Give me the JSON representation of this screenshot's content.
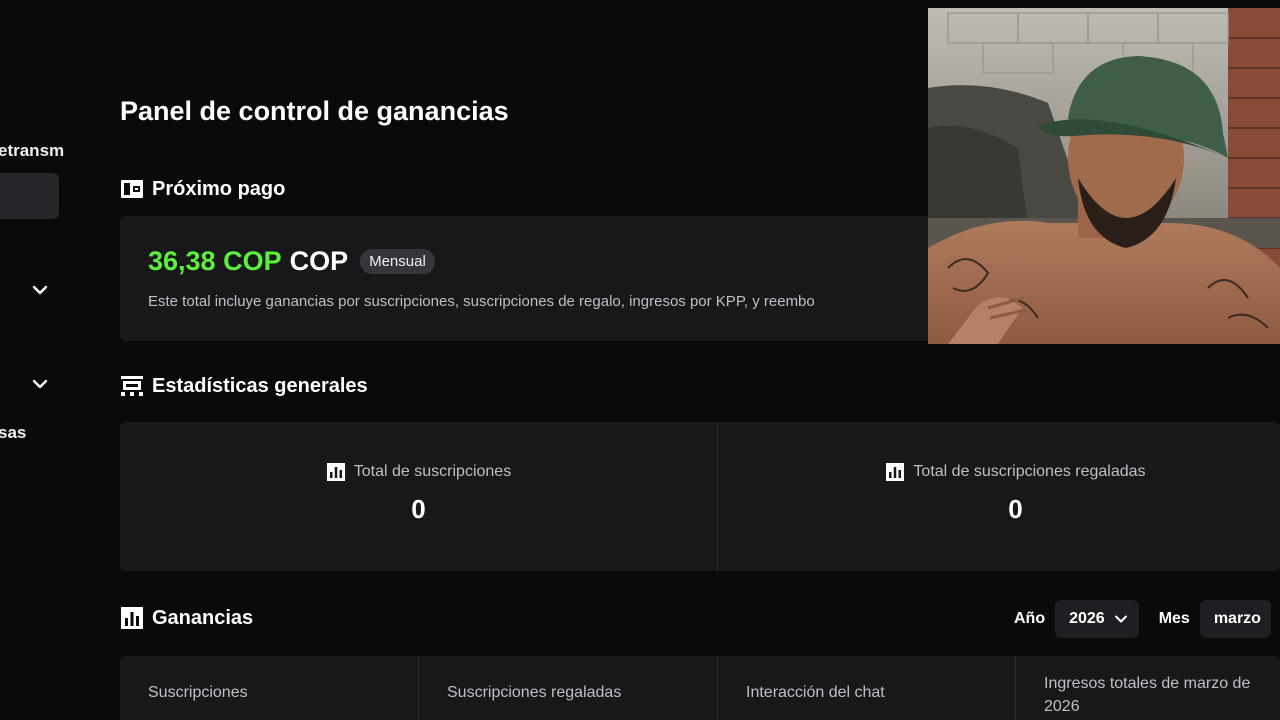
{
  "sidebar": {
    "items": [
      {
        "label": "etransm"
      },
      {
        "label": "sas"
      }
    ]
  },
  "page": {
    "title": "Panel de control de ganancias"
  },
  "next_payment": {
    "heading": "Próximo pago",
    "amount": "36,38 COP",
    "currency": "COP",
    "period_badge": "Mensual",
    "note": "Este total incluye ganancias por suscripciones, suscripciones de regalo, ingresos por KPP, y reembo"
  },
  "general_stats": {
    "heading": "Estadísticas generales",
    "stats": [
      {
        "label": "Total de suscripciones",
        "value": "0"
      },
      {
        "label": "Total de suscripciones regaladas",
        "value": "0"
      }
    ]
  },
  "earnings": {
    "heading": "Ganancias",
    "year_label": "Año",
    "year_value": "2026",
    "month_label": "Mes",
    "month_value": "marzo",
    "columns": [
      "Suscripciones",
      "Suscripciones regaladas",
      "Interacción del chat",
      "Ingresos totales de marzo de 2026"
    ]
  },
  "colors": {
    "accent_green": "#5cf03c",
    "background": "#0a0a0b",
    "card": "#18181b"
  },
  "icons": {
    "wallet": "wallet-icon",
    "stats": "presentation-icon",
    "bar_chart": "bar-chart-icon",
    "chevron": "chevron-down-icon"
  }
}
